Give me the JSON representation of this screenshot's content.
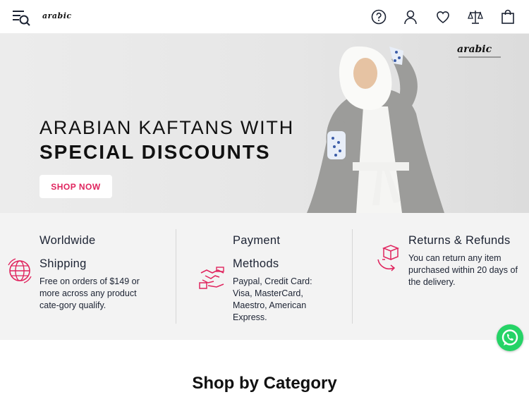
{
  "header": {
    "logo_text": "arabic",
    "icons": [
      "menu-search-icon",
      "help-icon",
      "user-icon",
      "heart-icon",
      "compare-icon",
      "bag-icon"
    ]
  },
  "hero": {
    "line1": "ARABIAN KAFTANS WITH",
    "line2": "SPECIAL DISCOUNTS",
    "button_label": "SHOP NOW",
    "brand_mark": "arabic"
  },
  "features": [
    {
      "title_line1": "Worldwide",
      "title_line2": "Shipping",
      "text": [
        "Free on orders of $149 or",
        "more across any product",
        "cate-gory qualify."
      ],
      "icon": "globe-icon"
    },
    {
      "title_line1": "Payment",
      "title_line2": "Methods",
      "text": [
        "Paypal, Credit Card:",
        "Visa, MasterCard,",
        "Maestro, American",
        "Express."
      ],
      "icon": "handshake-icon"
    },
    {
      "title_line1": "Returns & Refunds",
      "text": [
        "You can return any item",
        "purchased within 20 days of",
        "the delivery."
      ],
      "icon": "return-box-icon"
    }
  ],
  "section": {
    "title": "Shop by Category"
  },
  "colors": {
    "accent": "#e0245e",
    "whatsapp": "#25d366",
    "text": "#1c2333"
  }
}
